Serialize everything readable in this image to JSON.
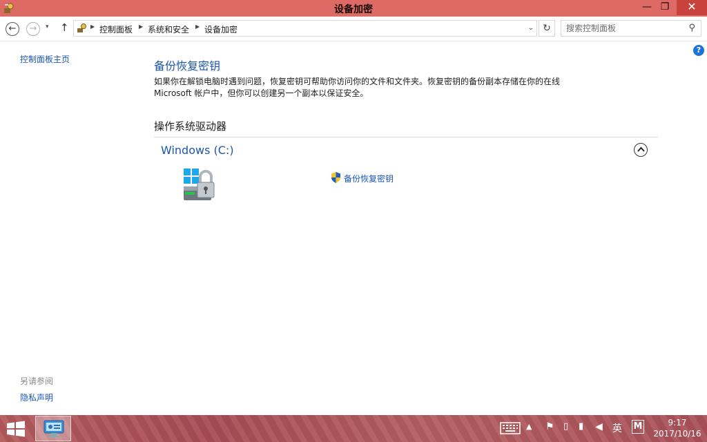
{
  "window": {
    "title": "设备加密",
    "minimize_glyph": "—",
    "maximize_glyph": "❐",
    "close_glyph": "✕"
  },
  "addressbar": {
    "back_glyph": "←",
    "forward_glyph": "→",
    "dropdown_glyph": "▾",
    "up_glyph": "↑",
    "breadcrumbs": [
      "控制面板",
      "系统和安全",
      "设备加密"
    ],
    "breadcrumb_sep": "▶",
    "breadcrumb_dropdown": "⌄",
    "refresh_glyph": "↻",
    "search_placeholder": "搜索控制面板",
    "search_glyph": "⚲"
  },
  "help_glyph": "?",
  "sidebar": {
    "home_link": "控制面板主页",
    "see_also_heading": "另请参阅",
    "privacy_link": "隐私声明"
  },
  "main": {
    "title": "备份恢复密钥",
    "description": "如果你在解锁电脑时遇到问题，恢复密钥可帮助你访问你的文件和文件夹。恢复密钥的备份副本存储在你的在线 Microsoft 帐户中，但你可以创建另一个副本以保证安全。",
    "section_title": "操作系统驱动器",
    "drive_name": "Windows (C:)",
    "backup_link": "备份恢复密钥"
  },
  "taskbar": {
    "up_arrow": "▲",
    "flag_glyph": "⚑",
    "power_glyph": "▯",
    "signal_glyph": "▮",
    "volume_glyph": "◀",
    "ime_label": "英",
    "m_label": "M",
    "clock_time": "9:17",
    "clock_date": "2017/10/16"
  },
  "colors": {
    "title_bar": "#dd6a64",
    "link_blue": "#1a56b8",
    "heading_blue": "#1c56aa",
    "close_button": "#c7433b"
  }
}
